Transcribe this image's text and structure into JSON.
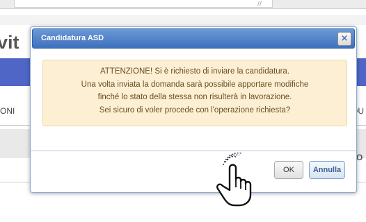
{
  "background": {
    "title_fragment": "vit",
    "column_left_fragment": "ONI",
    "column_right_fragment": "QU",
    "button_fragment": "O"
  },
  "dialog": {
    "title": "Candidatura ASD",
    "close_label": "×",
    "message_lines": [
      "ATTENZIONE! Si è richiesto di inviare la candidatura.",
      "Una volta inviata la domanda sarà possibile apportare modifiche",
      "finché lo stato della stessa non risulterà in lavorazione.",
      "Sei sicuro di voler procede con l'operazione richiesta?"
    ],
    "ok_label": "OK",
    "cancel_label": "Annulla"
  },
  "icons": [
    "close-icon",
    "hand-pointer-icon"
  ],
  "colors": {
    "dialog_header": "#3e71bd",
    "alert_background": "#fcefd4",
    "alert_text": "#6a4e1f",
    "page_accent_blue": "#4f66c7"
  }
}
